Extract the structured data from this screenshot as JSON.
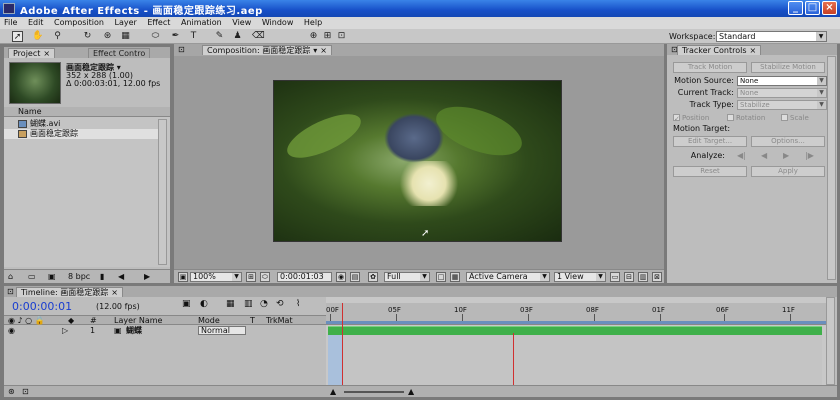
{
  "window": {
    "title": "Adobe After Effects - 画面稳定跟踪练习.aep",
    "btn_min": "_",
    "btn_max": "□",
    "btn_close": "×"
  },
  "menu": [
    "File",
    "Edit",
    "Composition",
    "Layer",
    "Effect",
    "Animation",
    "View",
    "Window",
    "Help"
  ],
  "toolbar": {
    "workspace_label": "Workspace:",
    "workspace_value": "Standard"
  },
  "project": {
    "tab_project": "Project",
    "tab_effect": "Effect Contro",
    "comp_name": "画面稳定跟踪 ▾",
    "dims": "352 x 288 (1.00)",
    "duration": "Δ 0:00:03:01, 12.00 fps",
    "col_name": "Name",
    "items": [
      {
        "name": "蝴蝶.avi"
      },
      {
        "name": "画面稳定跟踪"
      }
    ],
    "footer_bpc": "8 bpc"
  },
  "composition": {
    "tab_label": "Composition: 画面稳定跟踪",
    "zoom": "100%",
    "timecode": "0:00:01:03",
    "resolution": "Full",
    "camera": "Active Camera",
    "view": "1 View"
  },
  "tracker": {
    "tab_label": "Tracker Controls",
    "track_motion": "Track Motion",
    "stabilize_motion": "Stabilize Motion",
    "motion_source_label": "Motion Source:",
    "motion_source_value": "None",
    "current_track_label": "Current Track:",
    "current_track_value": "None",
    "track_type_label": "Track Type:",
    "track_type_value": "Stabilize",
    "cb_position": "Position",
    "cb_rotation": "Rotation",
    "cb_scale": "Scale",
    "motion_target_label": "Motion Target:",
    "edit_target": "Edit Target...",
    "options": "Options...",
    "analyze_label": "Analyze:",
    "reset": "Reset",
    "apply": "Apply"
  },
  "timeline": {
    "tab_label": "Timeline: 画面稳定跟踪",
    "current_time": "0:00:00:01",
    "fps": "(12.00 fps)",
    "col_layer_name": "Layer Name",
    "col_mode": "Mode",
    "col_t": "T",
    "col_trkmat": "TrkMat",
    "col_hash": "#",
    "layer": {
      "num": "1",
      "name": "蝴蝶",
      "mode": "Normal"
    },
    "ruler_ticks": [
      "00F",
      "05F",
      "10F",
      "03F",
      "08F",
      "01F",
      "06F",
      "11F"
    ]
  }
}
